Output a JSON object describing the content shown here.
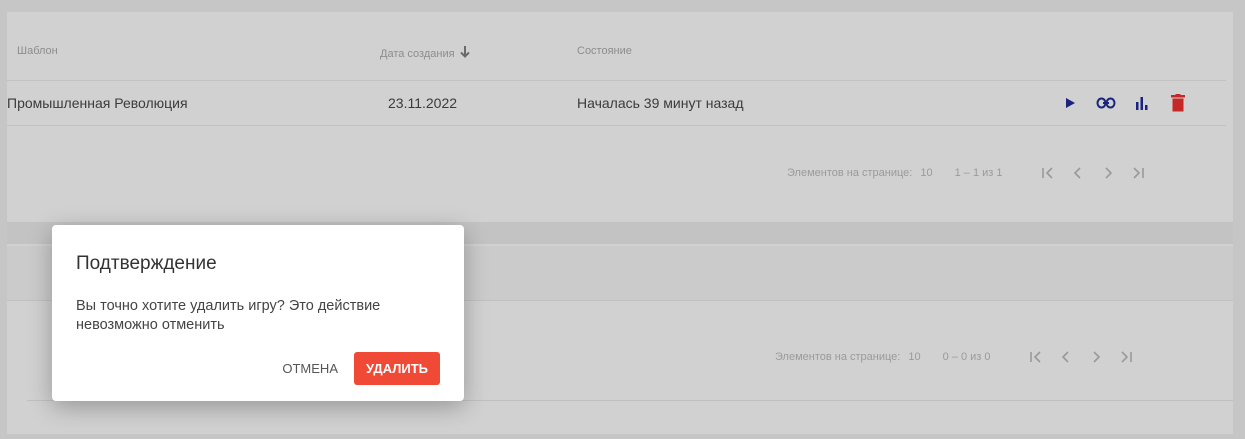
{
  "table": {
    "headers": {
      "template": "Шаблон",
      "date": "Дата создания",
      "state": "Состояние"
    },
    "rows": [
      {
        "template": "Промышленная Революция",
        "date": "23.11.2022",
        "state": "Началась 39 минут назад"
      }
    ]
  },
  "pager1": {
    "label": "Элементов на странице:",
    "size": "10",
    "range": "1 – 1 из 1"
  },
  "pager2": {
    "label": "Элементов на странице:",
    "size": "10",
    "range": "0 – 0 из 0"
  },
  "dialog": {
    "title": "Подтверждение",
    "message": "Вы точно хотите удалить игру? Это действие невозможно отменить",
    "cancel": "ОТМЕНА",
    "confirm": "УДАЛИТЬ"
  },
  "colors": {
    "accent": "#1a237e",
    "danger": "#f04a36",
    "overlay": "#c6c6c6"
  }
}
